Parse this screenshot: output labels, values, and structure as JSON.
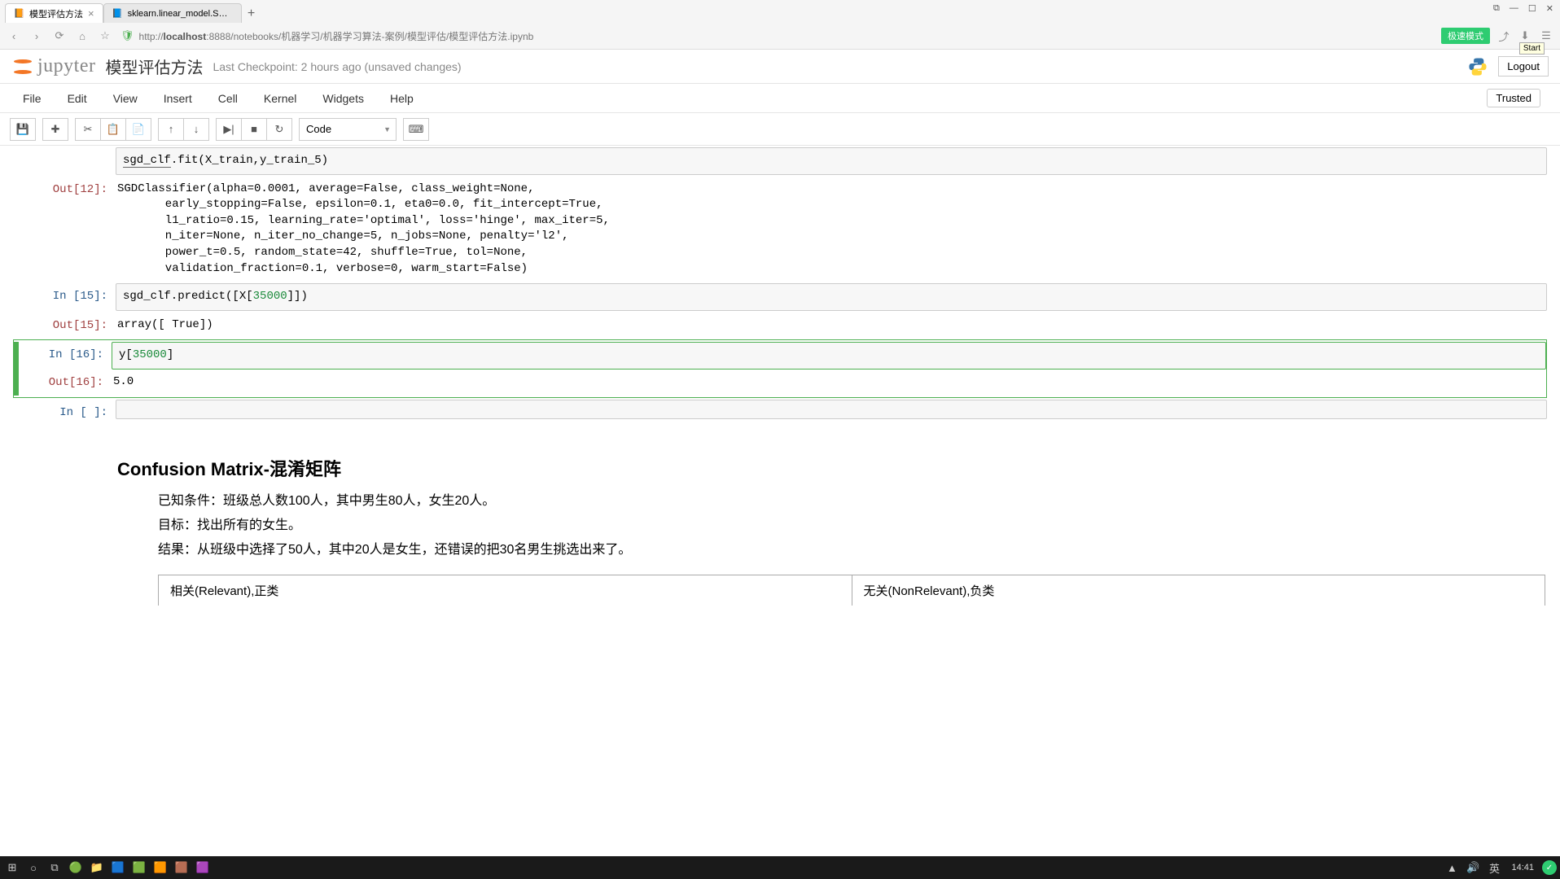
{
  "browser": {
    "tabs": [
      {
        "title": "模型评估方法",
        "active": true
      },
      {
        "title": "sklearn.linear_model.SGDClas",
        "active": false
      }
    ],
    "url_prefix": "http://",
    "url_host": "localhost",
    "url_suffix": ":8888/notebooks/机器学习/机器学习算法-案例/模型评估/模型评估方法.ipynb",
    "green_btn": "极速模式",
    "start_tip": "Start"
  },
  "window_controls": [
    "🗗",
    "—",
    "☐",
    "✕"
  ],
  "header": {
    "logo_text": "jupyter",
    "title": "模型评估方法",
    "checkpoint": "Last Checkpoint: 2 hours ago (unsaved changes)",
    "logout": "Logout"
  },
  "menu": [
    "File",
    "Edit",
    "View",
    "Insert",
    "Cell",
    "Kernel",
    "Widgets",
    "Help"
  ],
  "trusted": "Trusted",
  "toolbar": {
    "cell_type": "Code"
  },
  "cells": {
    "c1_code": "sgd_clf.fit(X_train,y_train_5)",
    "c1_out_prompt": "Out[12]:",
    "c1_out": "SGDClassifier(alpha=0.0001, average=False, class_weight=None,\n       early_stopping=False, epsilon=0.1, eta0=0.0, fit_intercept=True,\n       l1_ratio=0.15, learning_rate='optimal', loss='hinge', max_iter=5,\n       n_iter=None, n_iter_no_change=5, n_jobs=None, penalty='l2',\n       power_t=0.5, random_state=42, shuffle=True, tol=None,\n       validation_fraction=0.1, verbose=0, warm_start=False)",
    "c2_in_prompt": "In [15]:",
    "c2_code": "sgd_clf.predict([X[35000]])",
    "c2_out_prompt": "Out[15]:",
    "c2_out": "array([ True])",
    "c3_in_prompt": "In [16]:",
    "c3_code": "y[35000]",
    "c3_out_prompt": "Out[16]:",
    "c3_out": "5.0",
    "c4_in_prompt": "In [ ]:",
    "md_h3": "Confusion Matrix-混淆矩阵",
    "md_p1": "已知条件：班级总人数100人，其中男生80人，女生20人。",
    "md_p2": "目标：找出所有的女生。",
    "md_p3": "结果：从班级中选择了50人，其中20人是女生，还错误的把30名男生挑选出来了。",
    "table_h1": "相关(Relevant),正类",
    "table_h2": "无关(NonRelevant),负类"
  },
  "taskbar": {
    "time": "14:41"
  }
}
